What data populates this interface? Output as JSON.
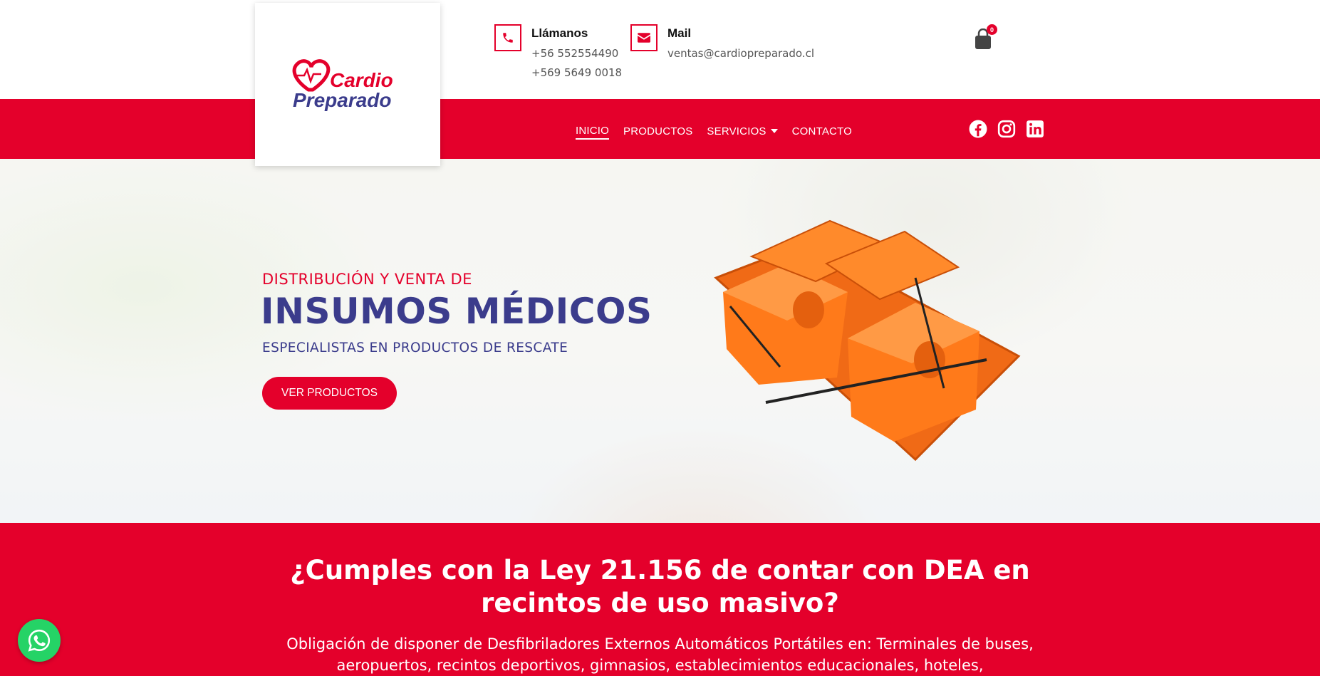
{
  "brand": {
    "logo_word1": "Cardio",
    "logo_word2": "Preparado",
    "primary_color": "#e4002b",
    "secondary_color": "#3b3c8c"
  },
  "header": {
    "phone": {
      "title": "Llámanos",
      "lines": [
        "+56 552554490",
        "+569 5649 0018"
      ],
      "icon": "phone-icon"
    },
    "mail": {
      "title": "Mail",
      "lines": [
        "ventas@cardiopreparado.cl"
      ],
      "icon": "envelope-icon"
    },
    "cart": {
      "count": "0",
      "icon": "shopping-bag-icon"
    }
  },
  "nav": {
    "items": [
      {
        "label": "INICIO",
        "active": true
      },
      {
        "label": "PRODUCTOS",
        "active": false
      },
      {
        "label": "SERVICIOS",
        "active": false,
        "dropdown": true
      },
      {
        "label": "CONTACTO",
        "active": false
      }
    ],
    "social": [
      "facebook-icon",
      "instagram-icon",
      "linkedin-icon"
    ]
  },
  "hero": {
    "pre_title": "DISTRIBUCIÓN Y VENTA DE",
    "title": "INSUMOS MÉDICOS",
    "subtitle": "ESPECIALISTAS EN PRODUCTOS DE RESCATE",
    "button_label": "VER PRODUCTOS",
    "product_image": "orange-head-immobilizer"
  },
  "law": {
    "title": "¿Cumples con la Ley 21.156 de contar con DEA en recintos de uso masivo?",
    "text": "Obligación de disponer de Desfibriladores Externos Automáticos Portátiles en: Terminales de buses, aeropuertos, recintos deportivos, gimnasios, establecimientos educacionales, hoteles,"
  },
  "whatsapp": {
    "icon": "whatsapp-icon"
  }
}
